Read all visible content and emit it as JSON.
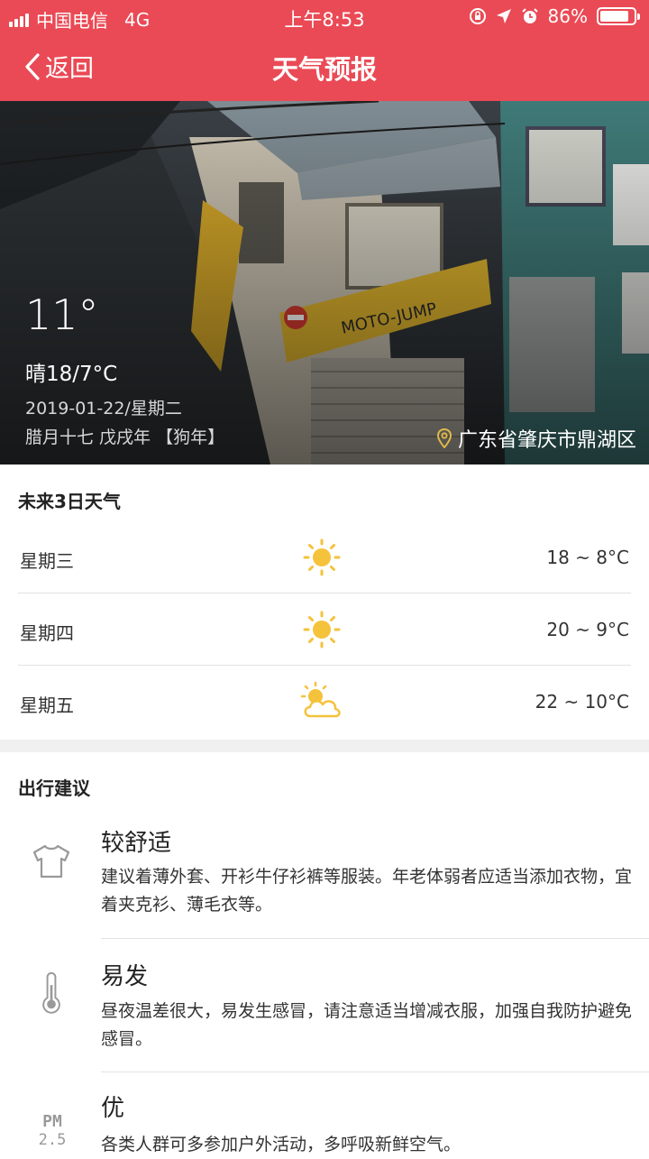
{
  "status": {
    "carrier": "中国电信",
    "network": "4G",
    "time": "上午8:53",
    "battery": "86%",
    "battery_level": 0.86
  },
  "nav": {
    "back_label": "返回",
    "title": "天气预报"
  },
  "today": {
    "temperature": "11°",
    "condition": "晴18/7°C",
    "date": "2019-01-22/星期二",
    "lunar": "腊月十七 戊戌年 【狗年】",
    "location": "广东省肇庆市鼎湖区"
  },
  "forecast": {
    "title": "未来3日天气",
    "days": [
      {
        "day": "星期三",
        "icon": "sun-icon",
        "range": "18 ~ 8°C"
      },
      {
        "day": "星期四",
        "icon": "sun-icon",
        "range": "20 ~ 9°C"
      },
      {
        "day": "星期五",
        "icon": "partly-cloudy-icon",
        "range": "22 ~ 10°C"
      }
    ]
  },
  "advice": {
    "title": "出行建议",
    "items": [
      {
        "icon": "tshirt-icon",
        "level": "较舒适",
        "text": "建议着薄外套、开衫牛仔衫裤等服装。年老体弱者应适当添加衣物，宜着夹克衫、薄毛衣等。"
      },
      {
        "icon": "thermometer-icon",
        "level": "易发",
        "text": "昼夜温差很大，易发生感冒，请注意适当增减衣服，加强自我防护避免感冒。"
      },
      {
        "icon": "pm25-icon",
        "icon_text_top": "PM",
        "icon_text_bottom": "2.5",
        "level": "优",
        "text": "各类人群可多参加户外活动，多呼吸新鲜空气。"
      }
    ]
  },
  "colors": {
    "brand": "#ea4a55",
    "sun": "#f5c23b",
    "hero_location": "#e0b94a"
  }
}
